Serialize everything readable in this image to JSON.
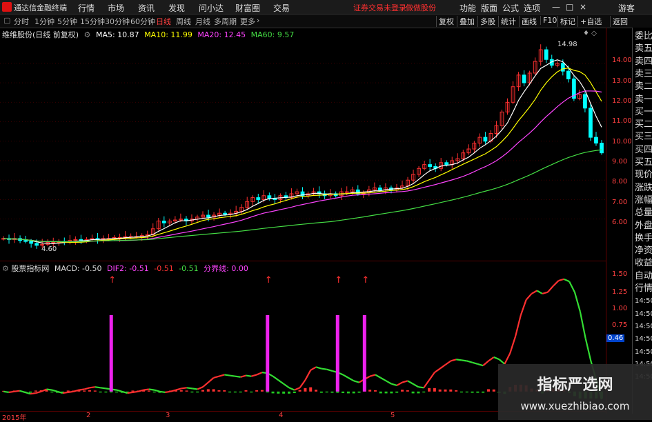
{
  "titlebar": {
    "app_name": "通达信金融终端",
    "menus": [
      "行情",
      "市场",
      "资讯",
      "发现",
      "问小达",
      "财富圈",
      "交易"
    ],
    "login_notice": "证券交易未登录",
    "broker": "做做股份",
    "right_menus": [
      "功能",
      "版面",
      "公式",
      "选项"
    ],
    "guest": "游客",
    "window_controls": [
      "—",
      "□",
      "×"
    ]
  },
  "periodbar": {
    "periods": [
      "分时",
      "1分钟",
      "5分钟",
      "15分钟",
      "30分钟",
      "60分钟",
      "日线",
      "周线",
      "月线",
      "多周期",
      "更多"
    ],
    "active": "日线",
    "more_arrow": "›",
    "tools": [
      "复权",
      "叠加",
      "多股",
      "统计",
      "画线",
      "F10",
      "标记",
      "+自选",
      "返回"
    ]
  },
  "main_chart": {
    "stock_title": "维维股份(日线 前复权)",
    "ma": [
      {
        "label": "MA5: 10.87",
        "color": "#ffffff"
      },
      {
        "label": "MA10: 11.99",
        "color": "#ffff00"
      },
      {
        "label": "MA20: 12.45",
        "color": "#ff44ff"
      },
      {
        "label": "MA60: 9.57",
        "color": "#44dd44"
      }
    ],
    "high_label": "14.98",
    "low_label": "4.60",
    "y_ticks": [
      "14.00",
      "13.00",
      "12.00",
      "11.00",
      "10.00",
      "9.00",
      "8.00",
      "7.00",
      "6.00"
    ],
    "marker": "♦  ◇"
  },
  "indicator": {
    "name": "股票指标网",
    "macd": "MACD: -0.50",
    "dif": "DIF2: -0.51",
    "dea": "-0.51",
    "ma": "-0.51",
    "fenjie": "分界线: 0.00",
    "y_ticks": [
      "1.50",
      "1.25",
      "1.00",
      "0.75",
      "0.46"
    ]
  },
  "dates": [
    "2015年",
    "2",
    "3",
    "4",
    "5"
  ],
  "right_panel": {
    "items": [
      "委比",
      "卖五",
      "卖四",
      "卖三",
      "卖二",
      "卖一",
      "买一",
      "买二",
      "买三",
      "买四",
      "买五",
      "现价",
      "涨跌",
      "涨幅",
      "总量",
      "外盘",
      "换手",
      "净资",
      "收益",
      "自动",
      "行情",
      "14:50",
      "14:50",
      "14:50",
      "14:50",
      "14:50",
      "14:50",
      "14:50"
    ]
  },
  "watermark": {
    "line1": "指标严选网",
    "line2": "www.xuezhibiao.com"
  },
  "colors": {
    "up": "#ff3030",
    "down": "#00ffff",
    "signal": "#ee22ee",
    "bg": "#000000"
  },
  "chart_data": [
    {
      "type": "candlestick",
      "title": "维维股份(日线 前复权)",
      "ylim": [
        4.5,
        15.2
      ],
      "close": [
        5.0,
        4.95,
        5.0,
        4.9,
        4.85,
        4.75,
        4.65,
        4.7,
        4.8,
        4.8,
        4.85,
        4.8,
        4.9,
        4.95,
        4.9,
        4.95,
        5.0,
        4.95,
        5.0,
        5.0,
        5.05,
        5.05,
        5.1,
        5.1,
        5.1,
        5.15,
        5.2,
        5.5,
        5.9,
        5.8,
        5.9,
        5.95,
        6.0,
        5.9,
        6.0,
        6.1,
        6.2,
        6.1,
        6.2,
        6.3,
        6.25,
        6.3,
        6.4,
        6.6,
        6.9,
        7.1,
        7.0,
        7.2,
        7.05,
        7.0,
        7.2,
        7.1,
        7.3,
        7.4,
        7.2,
        7.3,
        7.4,
        7.3,
        7.2,
        7.3,
        7.2,
        7.4,
        7.4,
        7.5,
        7.3,
        7.35,
        7.5,
        7.6,
        7.5,
        7.6,
        7.5,
        7.6,
        7.7,
        8.0,
        8.3,
        8.6,
        8.8,
        8.7,
        8.6,
        8.9,
        8.8,
        9.0,
        9.1,
        9.4,
        9.6,
        9.9,
        10.2,
        10.0,
        10.4,
        10.8,
        11.5,
        12.0,
        12.8,
        13.4,
        13.0,
        13.5,
        14.1,
        14.7,
        14.2,
        13.9,
        14.0,
        13.6,
        13.2,
        12.2,
        12.4,
        11.7,
        10.2,
        9.9,
        9.4
      ],
      "ma": {
        "MA5": {
          "color": "#ffffff",
          "value": 10.87
        },
        "MA10": {
          "color": "#ffff00",
          "value": 11.99
        },
        "MA20": {
          "color": "#ff44ff",
          "value": 12.45
        },
        "MA60": {
          "color": "#44dd44",
          "value": 9.57
        }
      },
      "annotations": {
        "high": 14.98,
        "low": 4.6
      }
    },
    {
      "type": "line",
      "title": "股票指标网",
      "ylim": [
        -0.2,
        1.55
      ],
      "series": [
        {
          "name": "DIF2",
          "values": [
            0.0,
            -0.01,
            0.0,
            0.01,
            -0.01,
            -0.03,
            -0.02,
            0.0,
            0.03,
            0.02,
            0.0,
            -0.02,
            -0.01,
            0.0,
            0.02,
            0.03,
            0.05,
            0.06,
            0.05,
            0.04,
            0.03,
            0.02,
            0.0,
            -0.02,
            -0.01,
            0.0,
            0.02,
            0.03,
            0.02,
            0.0,
            -0.01,
            0.0,
            0.02,
            0.04,
            0.05,
            0.04,
            0.03,
            0.06,
            0.12,
            0.18,
            0.2,
            0.22,
            0.21,
            0.2,
            0.19,
            0.21,
            0.2,
            0.22,
            0.25,
            0.24,
            0.2,
            0.15,
            0.1,
            0.05,
            0.02,
            0.05,
            0.15,
            0.28,
            0.32,
            0.3,
            0.29,
            0.27,
            0.25,
            0.22,
            0.18,
            0.14,
            0.12,
            0.16,
            0.2,
            0.22,
            0.18,
            0.14,
            0.1,
            0.08,
            0.12,
            0.14,
            0.1,
            0.06,
            0.05,
            0.15,
            0.25,
            0.3,
            0.35,
            0.4,
            0.42,
            0.41,
            0.4,
            0.38,
            0.36,
            0.34,
            0.4,
            0.45,
            0.42,
            0.36,
            0.5,
            0.72,
            1.0,
            1.2,
            1.28,
            1.32,
            1.28,
            1.3,
            1.38,
            1.45,
            1.47,
            1.44,
            1.3,
            1.05,
            0.7,
            0.4,
            0.15,
            -0.1
          ]
        }
      ],
      "signals": {
        "arrows": [
          "↑",
          "↑",
          "↑",
          "↑"
        ],
        "bars": 4
      }
    }
  ]
}
